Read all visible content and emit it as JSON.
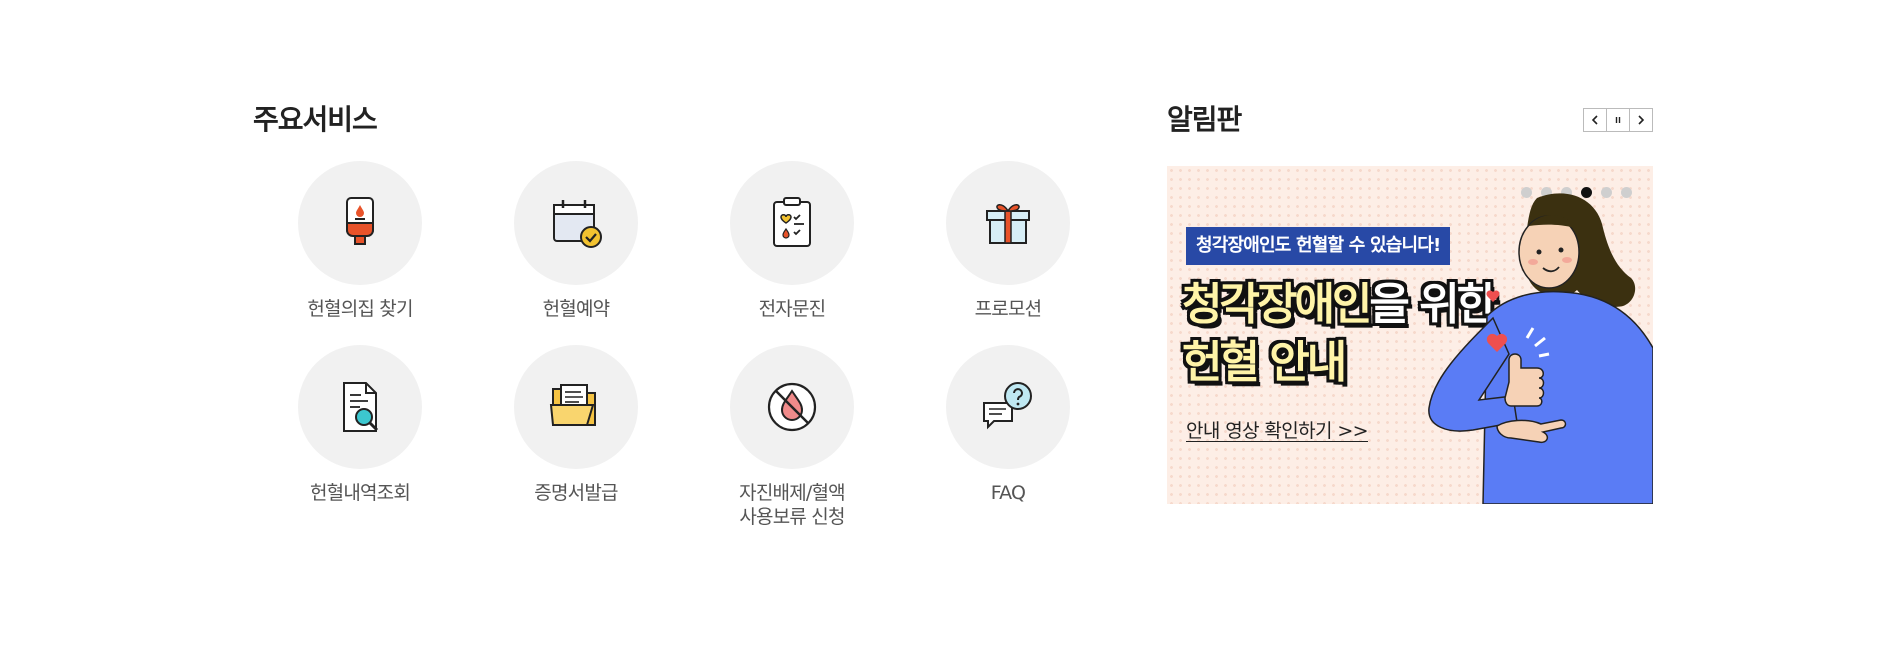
{
  "services": {
    "title": "주요서비스",
    "items": [
      {
        "label": "헌혈의집 찾기",
        "icon": "blood-bag-icon"
      },
      {
        "label": "헌혈예약",
        "icon": "calendar-check-icon"
      },
      {
        "label": "전자문진",
        "icon": "clipboard-checklist-icon"
      },
      {
        "label": "프로모션",
        "icon": "gift-box-icon"
      },
      {
        "label": "헌혈내역조회",
        "icon": "document-search-icon"
      },
      {
        "label": "증명서발급",
        "icon": "folder-documents-icon"
      },
      {
        "label": "자진배제/혈액\n사용보류 신청",
        "icon": "no-blood-drop-icon"
      },
      {
        "label": "FAQ",
        "icon": "chat-question-icon"
      }
    ]
  },
  "notice": {
    "title": "알림판",
    "controls": {
      "prev": "prev-arrow-icon",
      "pause": "pause-icon",
      "next": "next-arrow-icon"
    },
    "slides_total": 6,
    "active_slide": 4,
    "banner": {
      "tag": "청각장애인도 헌혈할 수 있습니다!",
      "headline_highlight": "청각장애인",
      "headline_rest": "을 위한",
      "headline_line2": "헌혈 안내",
      "cta": "안내 영상 확인하기 >>"
    }
  },
  "colors": {
    "circle_bg": "#f1f1f1",
    "accent_blue": "#2849a6",
    "banner_bg": "#fdeee6",
    "highlight_yellow": "#fff4a8",
    "blood_red": "#e8532a"
  }
}
